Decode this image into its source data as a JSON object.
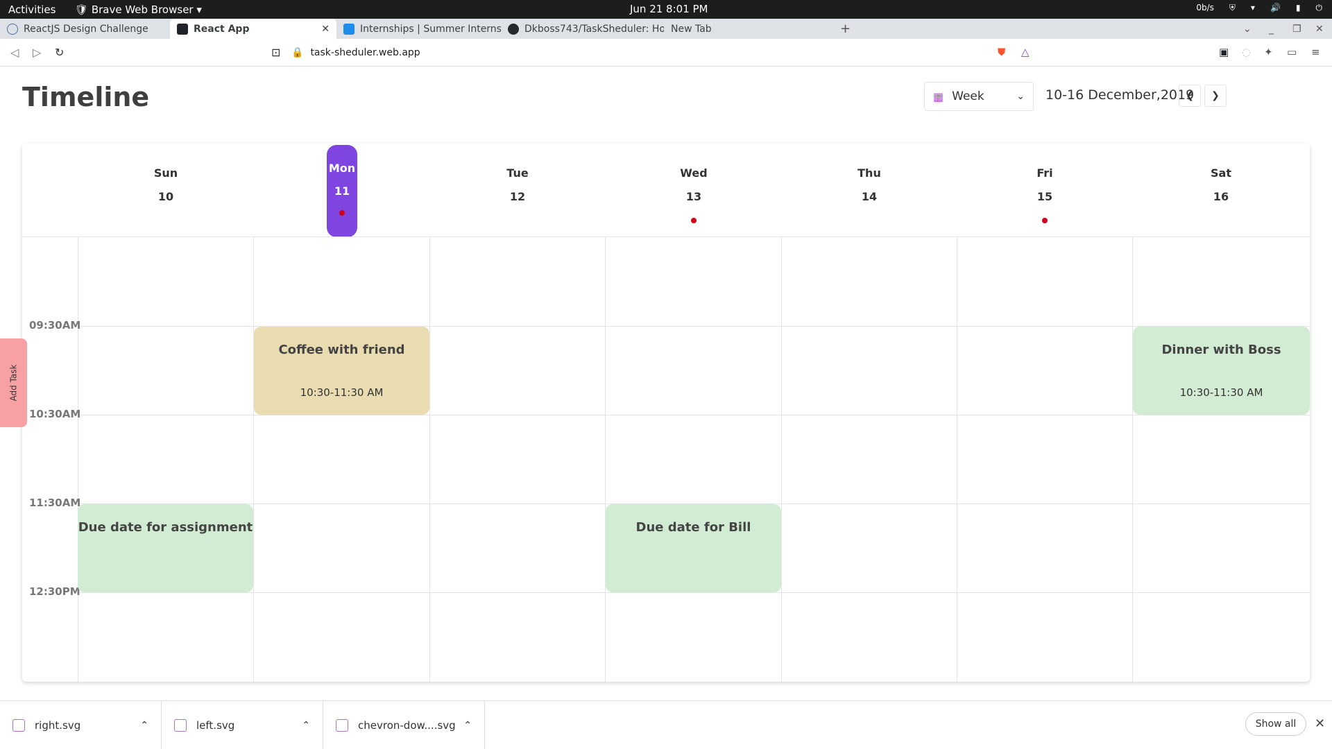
{
  "system": {
    "activities": "Activities",
    "app_name": "Brave Web Browser",
    "clock": "Jun 21  8:01 PM",
    "net": "0b/s"
  },
  "tabs": [
    {
      "label": "ReactJS Design Challenge"
    },
    {
      "label": "React App"
    },
    {
      "label": "Internships | Summer Internsh"
    },
    {
      "label": "Dkboss743/TaskSheduler: Ho"
    },
    {
      "label": "New Tab"
    }
  ],
  "address": {
    "url": "task-sheduler.web.app"
  },
  "header": {
    "title": "Timeline",
    "view": "Week",
    "date_range": "10-16 December,2019"
  },
  "days": [
    {
      "name": "Sun",
      "num": "10",
      "dot": false
    },
    {
      "name": "Mon",
      "num": "11",
      "dot": true,
      "selected": true
    },
    {
      "name": "Tue",
      "num": "12",
      "dot": false
    },
    {
      "name": "Wed",
      "num": "13",
      "dot": true
    },
    {
      "name": "Thu",
      "num": "14",
      "dot": false
    },
    {
      "name": "Fri",
      "num": "15",
      "dot": true
    },
    {
      "name": "Sat",
      "num": "16",
      "dot": false
    }
  ],
  "times": [
    "09:30AM",
    "10:30AM",
    "11:30AM",
    "12:30PM"
  ],
  "events": [
    {
      "title": "Coffee with friend",
      "time": "10:30-11:30 AM",
      "day": "Mon",
      "color": "#e8dcb0"
    },
    {
      "title": "Dinner with Boss",
      "time": "10:30-11:30 AM",
      "day": "Sat",
      "color": "#d2ecd4"
    },
    {
      "title": "Due date for assignment",
      "time": "",
      "day": "Sun",
      "color": "#d2ecd4"
    },
    {
      "title": "Due date for Bill",
      "time": "",
      "day": "Wed",
      "color": "#d2ecd4"
    }
  ],
  "add_task": "Add Task",
  "downloads": [
    {
      "name": "right.svg"
    },
    {
      "name": "left.svg"
    },
    {
      "name": "chevron-dow....svg"
    }
  ],
  "show_all": "Show all",
  "colors": {
    "accent": "#7e45e0",
    "dot": "#d0021b",
    "add_task": "#f7a1a4"
  }
}
